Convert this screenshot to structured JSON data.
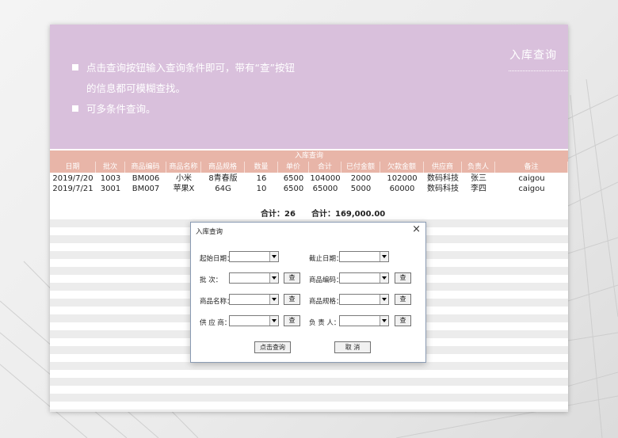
{
  "banner": {
    "title": "入库查询",
    "bullets": [
      {
        "line1": "点击查询按钮输入查询条件即可，带有“查”按钮",
        "line2": "的信息都可模糊查找。"
      },
      {
        "line1": "可多条件查询。",
        "line2": ""
      }
    ]
  },
  "grid": {
    "title": "入库查询",
    "columns": [
      "日期",
      "批次",
      "商品编码",
      "商品名称",
      "商品规格",
      "数量",
      "单价",
      "合计",
      "已付金额",
      "欠款金额",
      "供应商",
      "负责人",
      "备注"
    ],
    "rows": [
      [
        "2019/7/20",
        "1003",
        "BM006",
        "小米",
        "8青春版",
        "16",
        "6500",
        "104000",
        "2000",
        "102000",
        "数码科技",
        "张三",
        "caigou"
      ],
      [
        "2019/7/21",
        "3001",
        "BM007",
        "苹果X",
        "64G",
        "10",
        "6500",
        "65000",
        "5000",
        "60000",
        "数码科技",
        "李四",
        "caigou"
      ]
    ],
    "totals": {
      "count": "合计：26",
      "amount": "合计：169,000.00"
    }
  },
  "dialog": {
    "title": "入库查询",
    "close_glyph": "×",
    "start_date_label": "起始日期：",
    "end_date_label": "截止日期：",
    "batch_label": "批    次：",
    "code_label": "商品编码：",
    "name_label": "商品名称：",
    "spec_label": "商品规格：",
    "supplier_label": "供 应 商：",
    "owner_label": "负 责 人：",
    "search_button_label": "查",
    "submit_label": "点击查询",
    "cancel_label": "取  消",
    "start_date_value": "",
    "end_date_value": "",
    "batch_value": "",
    "code_value": "",
    "name_value": "",
    "spec_value": "",
    "supplier_value": "",
    "owner_value": ""
  }
}
